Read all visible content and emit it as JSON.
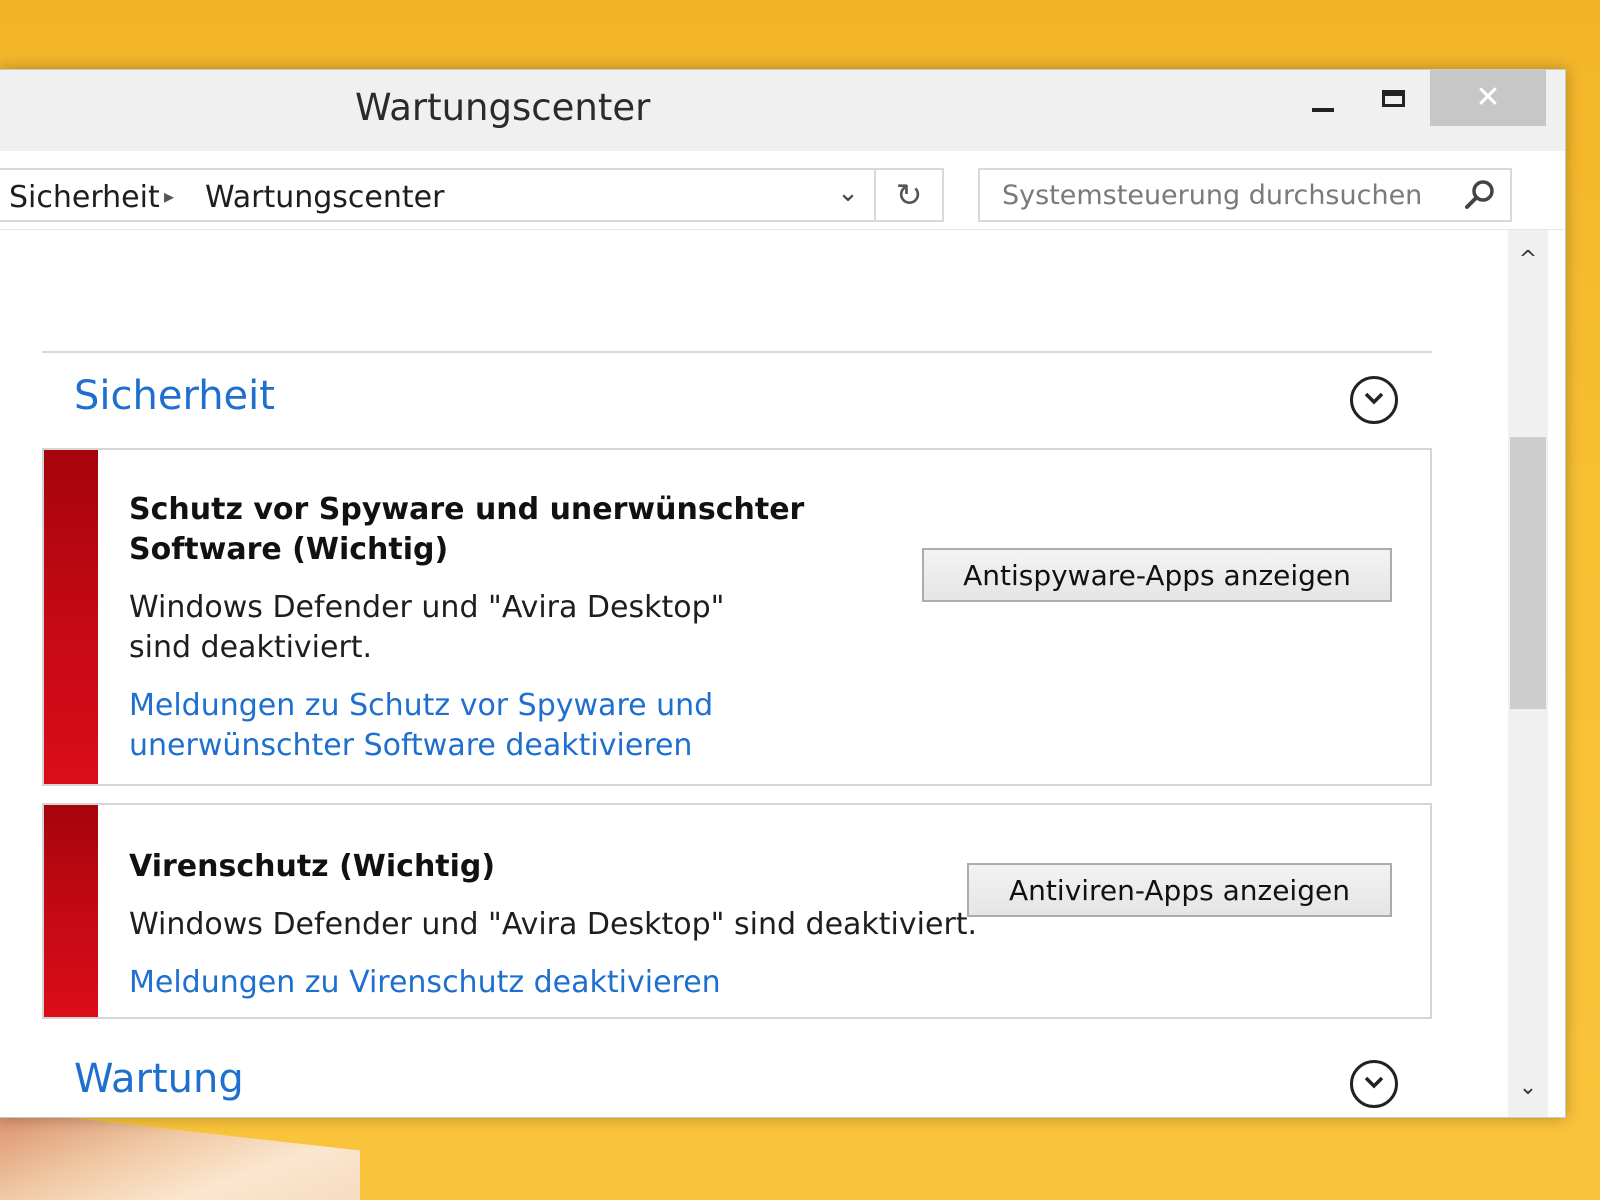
{
  "window": {
    "title": "Wartungscenter",
    "minimize_icon": "minimize-icon",
    "maximize_icon": "maximize-icon",
    "close_glyph": "✕"
  },
  "navbar": {
    "breadcrumbs": [
      "Sicherheit",
      "Wartungscenter"
    ],
    "separator_glyph": "▸",
    "dropdown_glyph": "⌄",
    "refresh_glyph": "↻",
    "search_placeholder": "Systemsteuerung durchsuchen",
    "search_icon": "search-icon"
  },
  "sections": {
    "security": {
      "title": "Sicherheit",
      "expander_icon": "chevron-down-circle-icon",
      "items": [
        {
          "title": "Schutz vor Spyware und unerwünschter Software (Wichtig)",
          "text": "Windows Defender und \"Avira Desktop\" sind deaktiviert.",
          "link": "Meldungen zu Schutz vor Spyware und unerwünschter Software deaktivieren",
          "button": "Antispyware-Apps anzeigen",
          "status_color": "#c30913"
        },
        {
          "title": "Virenschutz  (Wichtig)",
          "text": "Windows Defender und \"Avira Desktop\" sind deaktiviert.",
          "link": "Meldungen zu Virenschutz deaktivieren",
          "button": "Antiviren-Apps anzeigen",
          "status_color": "#c30913"
        }
      ]
    },
    "maintenance": {
      "title": "Wartung",
      "expander_icon": "chevron-down-circle-icon",
      "status_color": "#f0b22b"
    }
  },
  "scrollbar": {
    "up_glyph": "^",
    "down_glyph": "⌄"
  },
  "colors": {
    "accent_link": "#1f6fcf",
    "critical": "#c30913",
    "warning": "#f0b22b",
    "desktop": "#f7bf32"
  }
}
